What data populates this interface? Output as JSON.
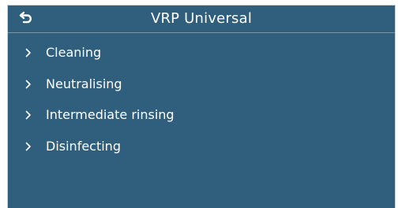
{
  "header": {
    "title": "VRP Universal",
    "back_icon": "return-arrow-icon"
  },
  "menu": {
    "items": [
      {
        "label": "Cleaning",
        "icon": "chevron-right-icon"
      },
      {
        "label": "Neutralising",
        "icon": "chevron-right-icon"
      },
      {
        "label": "Intermediate rinsing",
        "icon": "chevron-right-icon"
      },
      {
        "label": "Disinfecting",
        "icon": "chevron-right-icon"
      }
    ]
  },
  "colors": {
    "background": "#2f5f7d",
    "text": "#ffffff",
    "divider": "#7896aa"
  }
}
